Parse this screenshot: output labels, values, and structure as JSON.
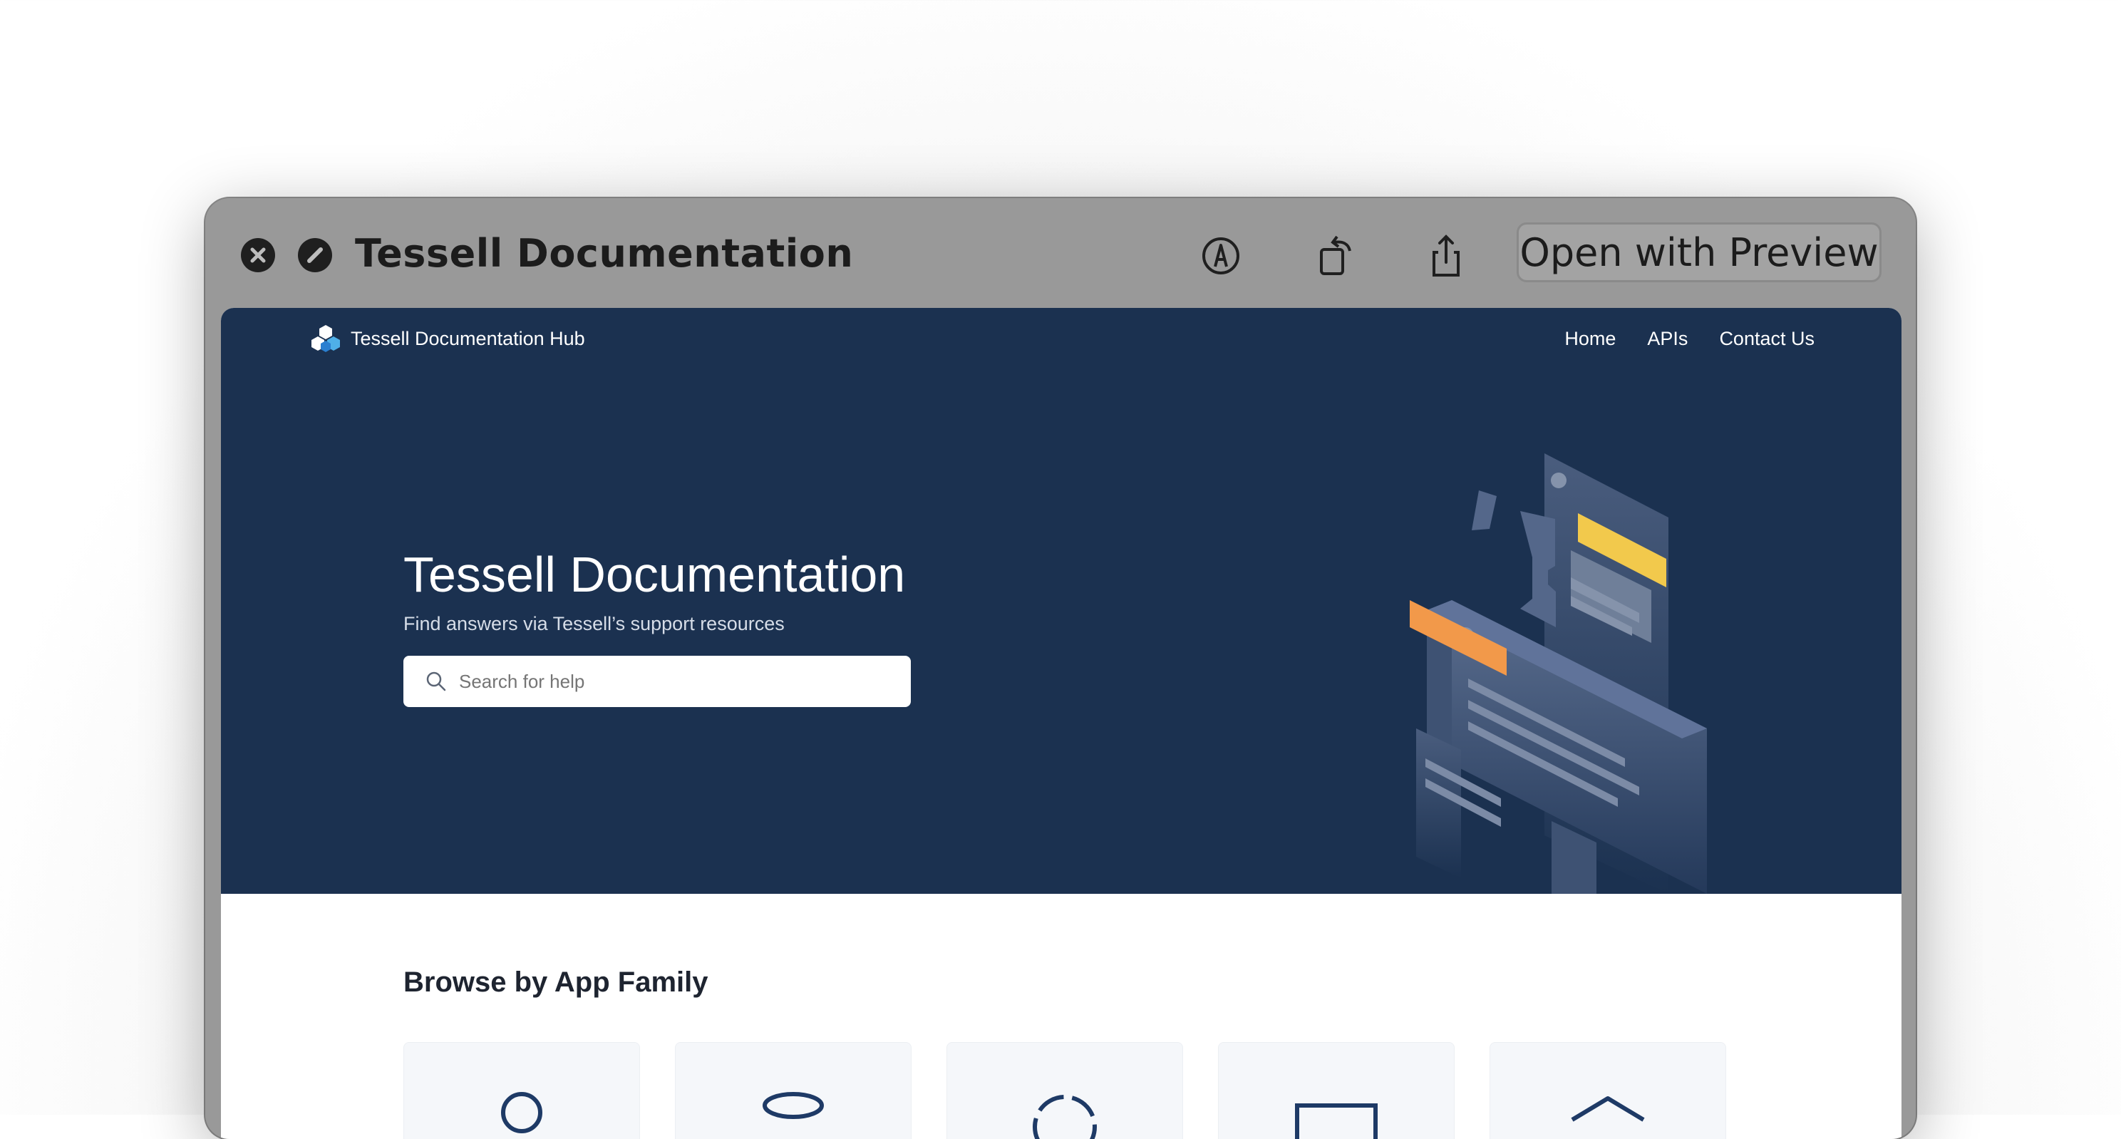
{
  "window": {
    "title": "Tessell Documentation",
    "open_button_label": "Open with Preview",
    "icons": [
      "close-icon",
      "hide-icon",
      "markup-icon",
      "rotate-icon",
      "share-icon"
    ]
  },
  "site": {
    "brand": "Tessell Documentation Hub",
    "nav": [
      "Home",
      "APIs",
      "Contact Us"
    ],
    "hero": {
      "title": "Tessell Documentation",
      "subtitle": "Find answers via Tessell’s support resources",
      "search_placeholder": "Search for help"
    },
    "browse_title": "Browse by App Family",
    "app_family_cards": 5
  },
  "colors": {
    "hero_bg": "#1b3150",
    "accent_yellow": "#f2c94c",
    "accent_orange": "#f2994a",
    "titlebar": "#999999"
  }
}
